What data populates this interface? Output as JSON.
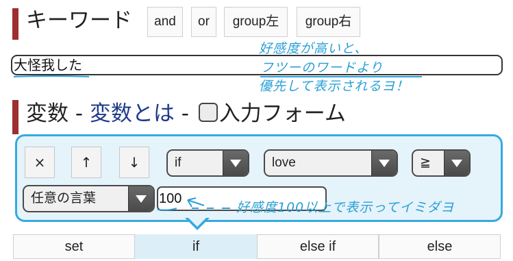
{
  "keyword_section": {
    "title": "キーワード",
    "buttons": [
      "and",
      "or",
      "group左",
      "group右"
    ],
    "input_value": "大怪我した",
    "annotation_lines": [
      "好感度が高いと、",
      "フツーのワードより",
      "優先して表示されるヨ！"
    ]
  },
  "variable_section": {
    "title_prefix": "変数 - ",
    "title_link": "変数とは",
    "title_sep": " - ",
    "title_suffix": "入力フォーム"
  },
  "condition_panel": {
    "buttons": {
      "delete": "×",
      "move_up": "↑",
      "move_down": "↓"
    },
    "operator_select": "if",
    "variable_select": "love",
    "comparison_select": "≧",
    "value_type_select": "任意の言葉",
    "value_input": "100",
    "annotation": "好感度100以上で表示ってイミダヨ"
  },
  "tabs": [
    "set",
    "if",
    "else if",
    "else"
  ],
  "active_tab": "if",
  "colors": {
    "section_bar": "#9c2f2f",
    "link": "#1f3a8a",
    "accent_blue": "#35a9e0",
    "panel_bg": "#e5f3fb"
  }
}
